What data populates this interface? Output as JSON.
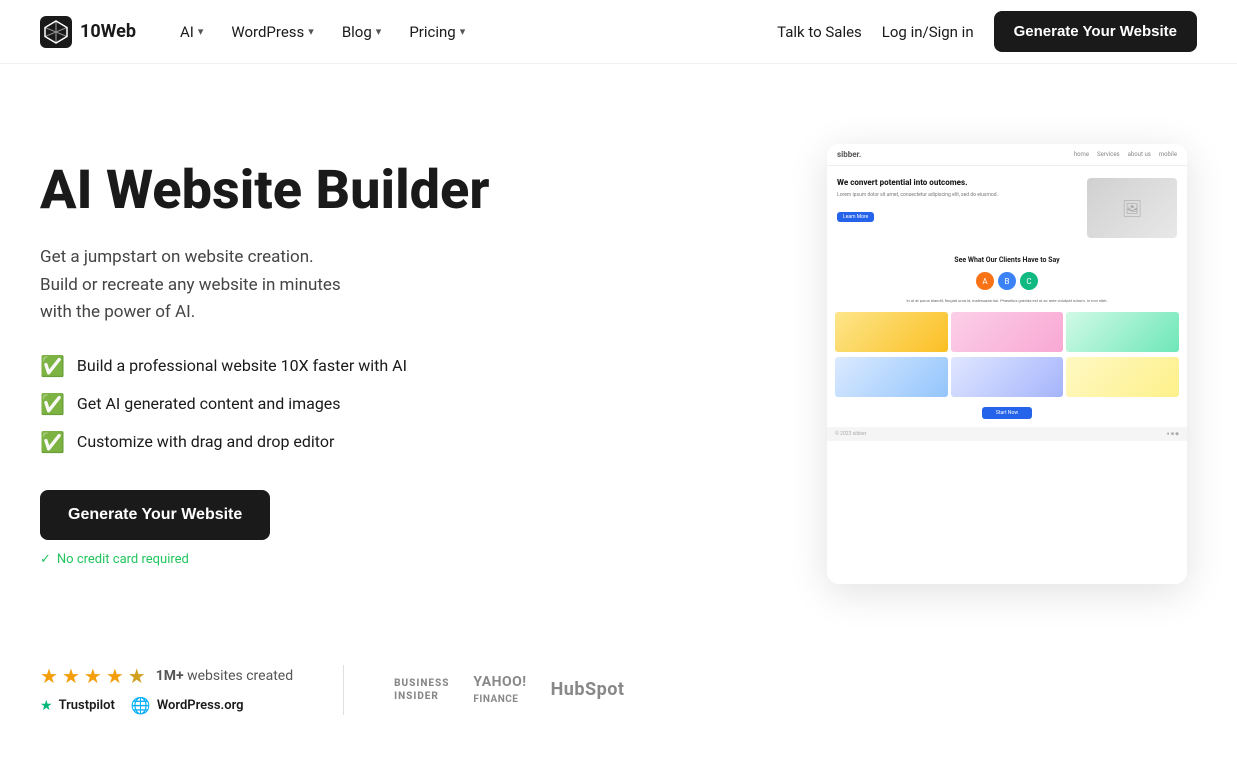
{
  "nav": {
    "logo_text": "10Web",
    "links": [
      {
        "label": "AI",
        "has_dropdown": true
      },
      {
        "label": "WordPress",
        "has_dropdown": true
      },
      {
        "label": "Blog",
        "has_dropdown": true
      },
      {
        "label": "Pricing",
        "has_dropdown": true
      }
    ],
    "right_links": [
      {
        "label": "Talk to Sales"
      },
      {
        "label": "Log in/Sign in"
      }
    ],
    "cta_label": "Generate Your Website"
  },
  "hero": {
    "title": "AI Website Builder",
    "subtitle_line1": "Get a jumpstart on website creation.",
    "subtitle_line2": "Build or recreate any website in minutes",
    "subtitle_line3": "with the power of AI.",
    "features": [
      "Build a professional website 10X faster with AI",
      "Get AI generated content and images",
      "Customize with drag and drop editor"
    ],
    "cta_label": "Generate Your Website",
    "no_cc_text": "No credit card required"
  },
  "mock": {
    "logo": "sibber.",
    "nav_links": [
      "home",
      "Services",
      "about us",
      "mobile"
    ],
    "hero_heading": "We convert potential into outcomes.",
    "hero_sub": "Lorem ipsum dolor sit amet, consectetur adipiscing elit, sed do eiusmod.",
    "hero_btn": "Learn More",
    "section_title": "See What Our Clients Have to Say",
    "testimonial": "In ut at purus blandit, feugiat urna id, malesuada dui. Phasellus gravida est ut ac ante volutpat rutrum.",
    "start_btn": "Start Now",
    "footer_left": "© 2023 sibber",
    "footer_right": "●  ■  ◆"
  },
  "social_proof": {
    "stars": [
      true,
      true,
      true,
      true,
      false
    ],
    "count_label": "1M+",
    "count_suffix": "websites created",
    "badges": [
      {
        "icon": "★",
        "label": "Trustpilot"
      },
      {
        "icon": "⊕",
        "label": "WordPress.org"
      }
    ],
    "brands": [
      {
        "label": "BUSINESS\nINSIDER",
        "class": "business-insider"
      },
      {
        "label": "YAHOO!\nFINANCE",
        "class": "yahoo"
      },
      {
        "label": "HubSpot",
        "class": "hubspot"
      }
    ]
  }
}
